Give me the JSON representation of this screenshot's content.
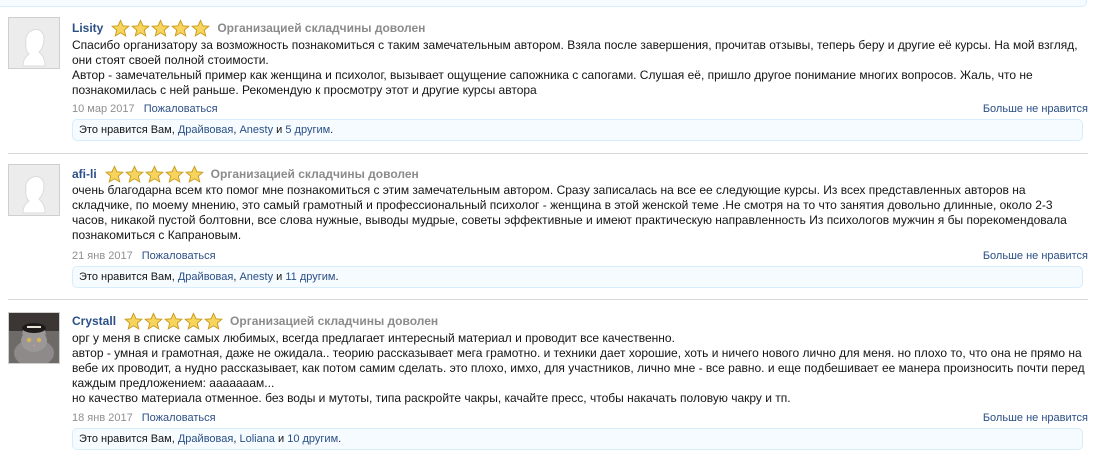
{
  "posts": [
    {
      "username": "Lisity",
      "rating_text": "Организацией складчины доволен",
      "message_lines": [
        "Спасибо организатору за возможность познакомиться с таким замечательным автором. Взяла после завершения, прочитав отзывы, теперь беру и другие её курсы. На мой взгляд,",
        "они стоят своей полной стоимости.",
        "Автор - замечательный пример как женщина и психолог, вызывает ощущение сапожника с сапогами. Слушая её, пришло другое понимание многих вопросов. Жаль, что не",
        "познакомилась с ней раньше. Рекомендую к просмотру этот и другие курсы автора"
      ],
      "date": "10 мар 2017",
      "report": "Пожаловаться",
      "unlike": "Больше не нравится",
      "likes": {
        "prefix": "Это нравится Вам, ",
        "user1": "Драйвовая",
        "comma": ", ",
        "user2": "Anesty",
        "and": " и ",
        "others": "5 другим",
        "end": "."
      }
    },
    {
      "username": "afi-li",
      "rating_text": "Организацией складчины доволен",
      "message_lines": [
        "очень благодарна всем кто помог мне познакомиться с этим замечательным автором. Сразу записалась на все ее следующие курсы. Из всех представленных авторов на",
        "складчике, по моему мнению, это самый грамотный и профессиональный психолог - женщина в этой женской теме .Не смотря на то что занятия довольно длинные, около 2-3",
        "часов, никакой пустой болтовни, все слова нужные, выводы мудрые, советы эффективные и имеют практическую направленность Из психологов мужчин я бы порекомендовала",
        "познакомиться с Капрановым."
      ],
      "date": "21 янв 2017",
      "report": "Пожаловаться",
      "unlike": "Больше не нравится",
      "likes": {
        "prefix": "Это нравится Вам, ",
        "user1": "Драйвовая",
        "comma": ", ",
        "user2": "Anesty",
        "and": " и ",
        "others": "11 другим",
        "end": "."
      }
    },
    {
      "username": "Crystall",
      "rating_text": "Организацией складчины доволен",
      "message_lines": [
        "орг у меня в списке самых любимых, всегда предлагает интересный материал и проводит все качественно.",
        "автор - умная и грамотная, даже не ожидала.. теорию рассказывает мега грамотно. и техники дает хорошие, хоть и ничего нового лично для меня. но плохо то, что она не прямо на",
        "вебе их проводит, а нудно рассказывает, как потом самим сделать. это плохо, имхо, для участников, лично мне - все равно. и еще подбешивает ее манера произносить почти перед",
        "каждым предложением: ааааааам...",
        "но качество материала отменное. без воды и мутоты, типа раскройте чакры, качайте пресс, чтобы накачать половую чакру и тп."
      ],
      "date": "18 янв 2017",
      "report": "Пожаловаться",
      "unlike": "Больше не нравится",
      "likes": {
        "prefix": "Это нравится Вам, ",
        "user1": "Драйвовая",
        "comma": ", ",
        "user2": "Loliana",
        "and": " и ",
        "others": "10 другим",
        "end": "."
      }
    }
  ],
  "rating_value": 5,
  "rating_max": 5,
  "colors": {
    "link": "#2b4f86",
    "star": "#f2c53d",
    "muted": "#8f8f8f",
    "likes_bg": "#f5fbff",
    "likes_border": "#d7edfc"
  },
  "icons": {
    "star": "star-icon",
    "avatar_default": "default-avatar-silhouette",
    "avatar_cat": "cat-avatar-photo"
  }
}
